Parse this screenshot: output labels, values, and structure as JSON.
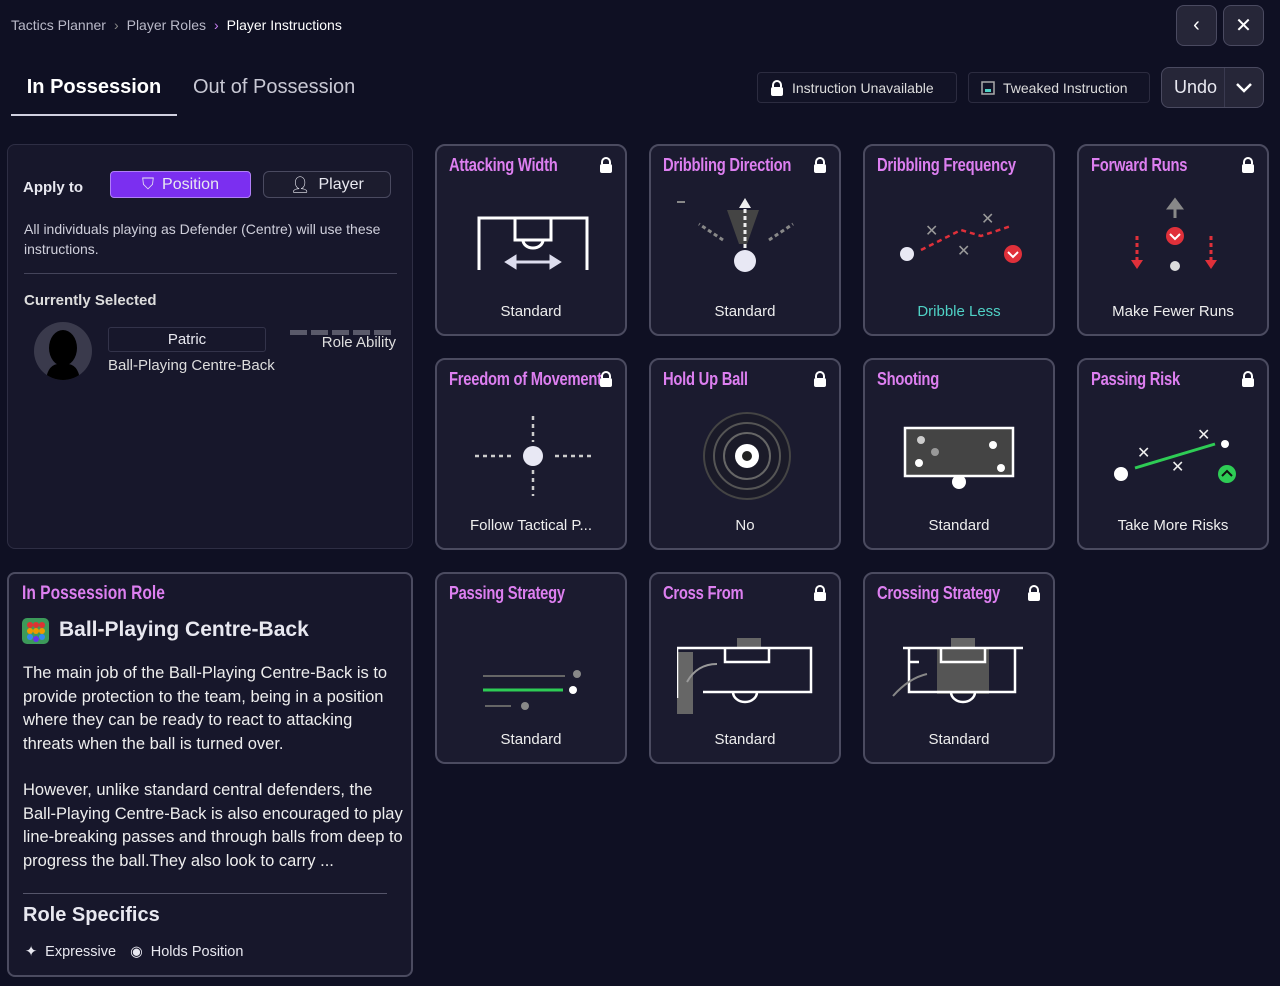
{
  "breadcrumb": [
    "Tactics Planner",
    "Player Roles",
    "Player Instructions"
  ],
  "tabs": {
    "in_possession": "In Possession",
    "out_of_possession": "Out of Possession"
  },
  "legend": {
    "unavailable": "Instruction Unavailable",
    "tweaked": "Tweaked Instruction"
  },
  "undo": "Undo",
  "apply": {
    "label": "Apply to",
    "position": "Position",
    "player": "Player",
    "description": "All individuals playing as Defender (Centre) will use these instructions."
  },
  "selected": {
    "heading": "Currently Selected",
    "name": "Patric",
    "role": "Ball-Playing Centre-Back",
    "role_ability_label": "Role Ability",
    "role_ability_segments": 5
  },
  "role_panel": {
    "heading": "In Possession Role",
    "role": "Ball-Playing Centre-Back",
    "p1": "The main job of the Ball-Playing Centre-Back is to provide protection to the team, being in a position where they can be ready to react to attacking threats when the ball is turned over.",
    "p2": "However, unlike standard central defenders, the Ball-Playing Centre-Back is also encouraged to play line-breaking passes and through balls from deep to progress the ball.They also look to carry ...",
    "specifics_heading": "Role Specifics",
    "specifics": [
      "Expressive",
      "Holds Position"
    ]
  },
  "cards": [
    {
      "title": "Attacking Width",
      "value": "Standard",
      "locked": true
    },
    {
      "title": "Dribbling Direction",
      "value": "Standard",
      "locked": true
    },
    {
      "title": "Dribbling Frequency",
      "value": "Dribble Less",
      "locked": false,
      "tweaked": true
    },
    {
      "title": "Forward Runs",
      "value": "Make Fewer Runs",
      "locked": true
    },
    {
      "title": "Freedom of Movement",
      "value": "Follow Tactical P...",
      "locked": true
    },
    {
      "title": "Hold Up Ball",
      "value": "No",
      "locked": true
    },
    {
      "title": "Shooting",
      "value": "Standard",
      "locked": false
    },
    {
      "title": "Passing Risk",
      "value": "Take More Risks",
      "locked": true
    },
    {
      "title": "Passing Strategy",
      "value": "Standard",
      "locked": false
    },
    {
      "title": "Cross From",
      "value": "Standard",
      "locked": true
    },
    {
      "title": "Crossing Strategy",
      "value": "Standard",
      "locked": true
    }
  ],
  "colors": {
    "accent": "#dd7ff0",
    "position_button": "#7b2ff0",
    "tweaked": "#4fd1c5",
    "negative": "#e0303a",
    "positive": "#2ecc55"
  }
}
